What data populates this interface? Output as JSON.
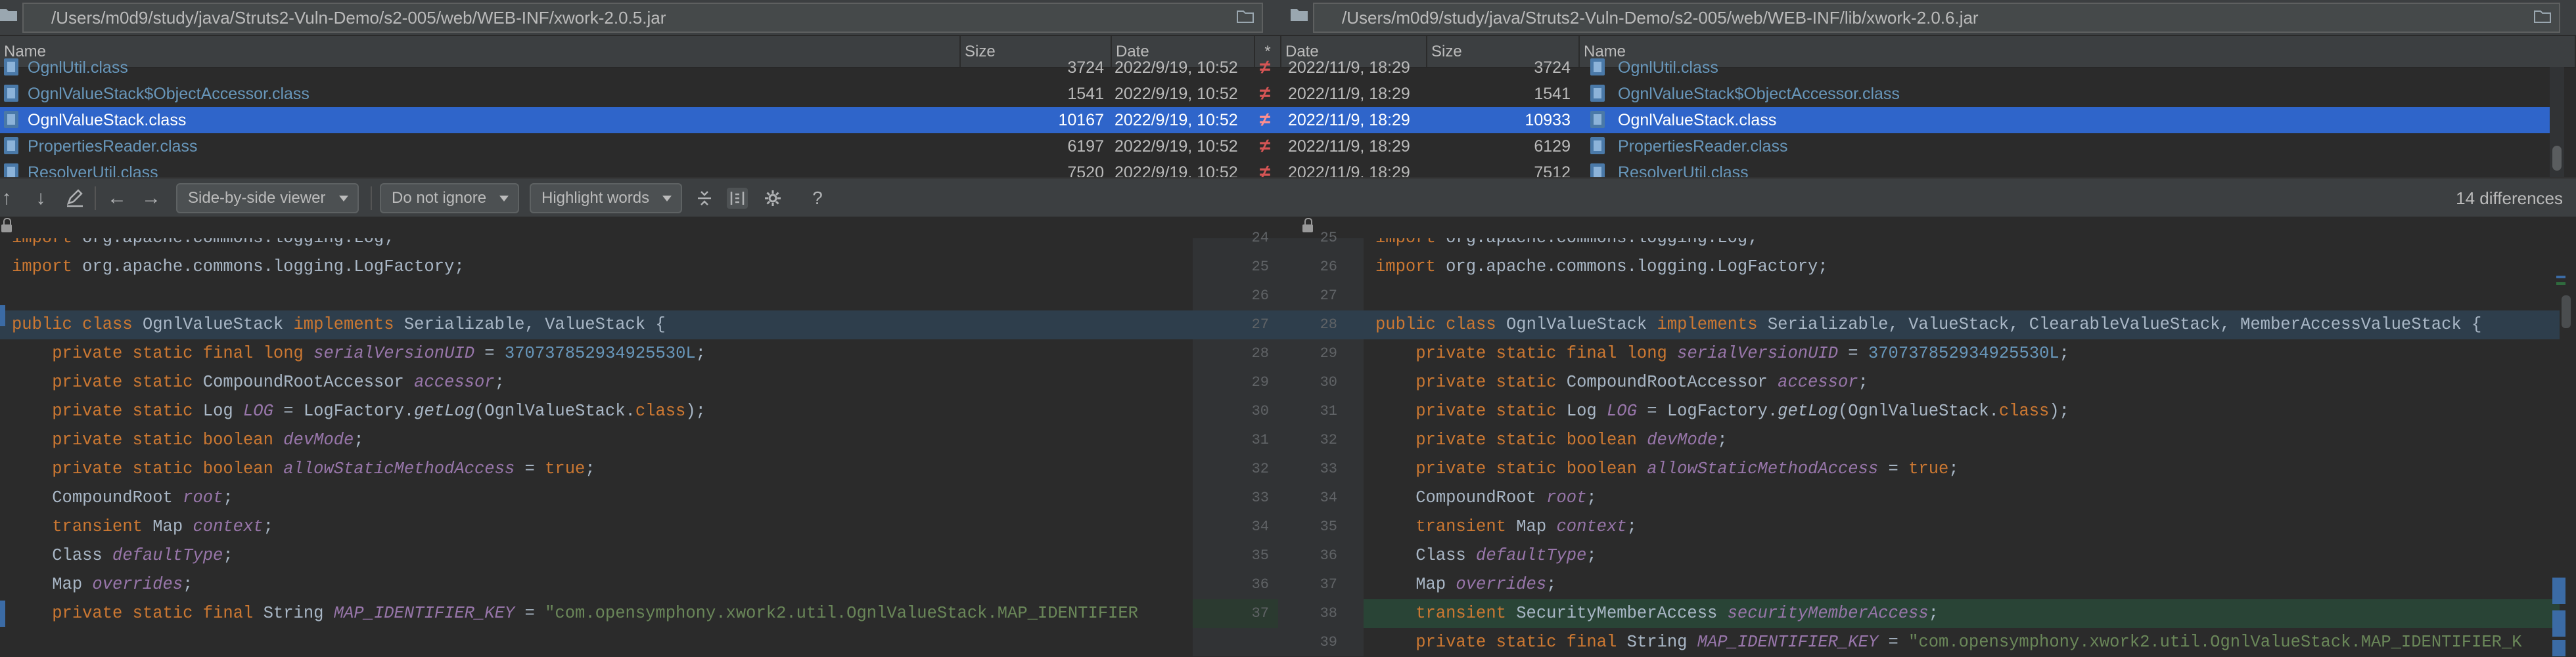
{
  "paths": {
    "left": "/Users/m0d9/study/java/Struts2-Vuln-Demo/s2-005/web/WEB-INF/xwork-2.0.5.jar",
    "right": "/Users/m0d9/study/java/Struts2-Vuln-Demo/s2-005/web/WEB-INF/lib/xwork-2.0.6.jar"
  },
  "table": {
    "headers": {
      "name_left": "Name",
      "size_left": "Size",
      "date_left": "Date",
      "marker": "*",
      "date_right": "Date",
      "size_right": "Size",
      "name_right": "Name"
    },
    "rows": [
      {
        "name_left": "OgnlUtil.class",
        "size_left": "3724",
        "date_left": "2022/9/19, 10:52",
        "marker": "≠",
        "date_right": "2022/11/9, 18:29",
        "size_right": "3724",
        "name_right": "OgnlUtil.class",
        "selected": false
      },
      {
        "name_left": "OgnlValueStack$ObjectAccessor.class",
        "size_left": "1541",
        "date_left": "2022/9/19, 10:52",
        "marker": "≠",
        "date_right": "2022/11/9, 18:29",
        "size_right": "1541",
        "name_right": "OgnlValueStack$ObjectAccessor.class",
        "selected": false
      },
      {
        "name_left": "OgnlValueStack.class",
        "size_left": "10167",
        "date_left": "2022/9/19, 10:52",
        "marker": "≠",
        "date_right": "2022/11/9, 18:29",
        "size_right": "10933",
        "name_right": "OgnlValueStack.class",
        "selected": true
      },
      {
        "name_left": "PropertiesReader.class",
        "size_left": "6197",
        "date_left": "2022/9/19, 10:52",
        "marker": "≠",
        "date_right": "2022/11/9, 18:29",
        "size_right": "6129",
        "name_right": "PropertiesReader.class",
        "selected": false
      },
      {
        "name_left": "ResolverUtil.class",
        "size_left": "7520",
        "date_left": "2022/9/19, 10:52",
        "marker": "≠",
        "date_right": "2022/11/9, 18:29",
        "size_right": "7512",
        "name_right": "ResolverUtil.class",
        "selected": false
      }
    ]
  },
  "toolbar": {
    "viewer": "Side-by-side viewer",
    "ignore": "Do not ignore",
    "highlight": "Highlight words",
    "help": "?",
    "differences": "14 differences"
  },
  "gutter": [
    {
      "left": "24",
      "right": "25",
      "state": "normal"
    },
    {
      "left": "25",
      "right": "26",
      "state": "normal"
    },
    {
      "left": "26",
      "right": "27",
      "state": "normal"
    },
    {
      "left": "27",
      "right": "28",
      "state": "changed"
    },
    {
      "left": "28",
      "right": "29",
      "state": "normal"
    },
    {
      "left": "29",
      "right": "30",
      "state": "normal"
    },
    {
      "left": "30",
      "right": "31",
      "state": "normal"
    },
    {
      "left": "31",
      "right": "32",
      "state": "normal"
    },
    {
      "left": "32",
      "right": "33",
      "state": "normal"
    },
    {
      "left": "33",
      "right": "34",
      "state": "normal"
    },
    {
      "left": "34",
      "right": "35",
      "state": "normal"
    },
    {
      "left": "35",
      "right": "36",
      "state": "normal"
    },
    {
      "left": "36",
      "right": "37",
      "state": "normal"
    },
    {
      "left": "37",
      "right": "38",
      "state": "inserted"
    },
    {
      "left": "",
      "right": "39",
      "state": "normal"
    }
  ],
  "left_code": [
    "import org.apache.commons.logging.Log;",
    "import org.apache.commons.logging.LogFactory;",
    "",
    "public class OgnlValueStack implements Serializable, ValueStack {",
    "    private static final long serialVersionUID = 370737852934925530L;",
    "    private static CompoundRootAccessor accessor;",
    "    private static Log LOG = LogFactory.getLog(OgnlValueStack.class);",
    "    private static boolean devMode;",
    "    private static boolean allowStaticMethodAccess = true;",
    "    CompoundRoot root;",
    "    transient Map context;",
    "    Class defaultType;",
    "    Map overrides;",
    "    private static final String MAP_IDENTIFIER_KEY = \"com.opensymphony.xwork2.util.OgnlValueStack.MAP_IDENTIFIER"
  ],
  "right_code": [
    "import org.apache.commons.logging.Log;",
    "import org.apache.commons.logging.LogFactory;",
    "",
    "public class OgnlValueStack implements Serializable, ValueStack, ClearableValueStack, MemberAccessValueStack {",
    "    private static final long serialVersionUID = 370737852934925530L;",
    "    private static CompoundRootAccessor accessor;",
    "    private static Log LOG = LogFactory.getLog(OgnlValueStack.class);",
    "    private static boolean devMode;",
    "    private static boolean allowStaticMethodAccess = true;",
    "    CompoundRoot root;",
    "    transient Map context;",
    "    Class defaultType;",
    "    Map overrides;",
    "    transient SecurityMemberAccess securityMemberAccess;",
    "    private static final String MAP_IDENTIFIER_KEY = \"com.opensymphony.xwork2.util.OgnlValueStack.MAP_IDENTIFIER_K"
  ],
  "colors": {
    "selection": "#2f65ca",
    "changed": "#2e3e4c",
    "inserted": "#294436",
    "keyword": "#cc7832",
    "field": "#9876aa",
    "number": "#6897bb",
    "string": "#6a8759"
  }
}
